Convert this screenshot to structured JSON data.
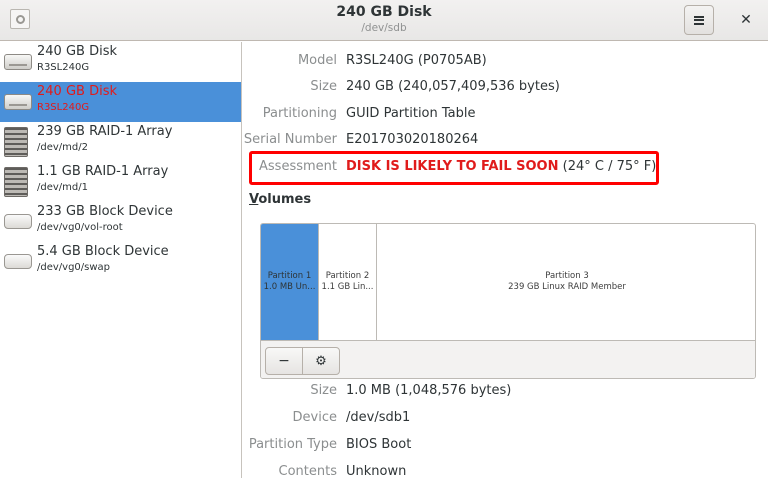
{
  "header": {
    "title": "240 GB Disk",
    "subtitle": "/dev/sdb",
    "menu_icon": "hamburger-menu-icon",
    "close_label": "✕"
  },
  "sidebar": {
    "items": [
      {
        "name": "240 GB Disk",
        "sub": "R3SL240G",
        "icon": "disk-icon",
        "selected": false
      },
      {
        "name": "240 GB Disk",
        "sub": "R3SL240G",
        "icon": "disk-icon",
        "selected": true
      },
      {
        "name": "239 GB RAID-1 Array",
        "sub": "/dev/md/2",
        "icon": "raid-icon",
        "selected": false
      },
      {
        "name": "1.1 GB RAID-1 Array",
        "sub": "/dev/md/1",
        "icon": "raid-icon",
        "selected": false
      },
      {
        "name": "233 GB Block Device",
        "sub": "/dev/vg0/vol-root",
        "icon": "block-icon",
        "selected": false
      },
      {
        "name": "5.4 GB Block Device",
        "sub": "/dev/vg0/swap",
        "icon": "block-icon",
        "selected": false
      }
    ]
  },
  "details": {
    "model": {
      "label": "Model",
      "value": "R3SL240G (P0705AB)"
    },
    "size": {
      "label": "Size",
      "value": "240 GB (240,057,409,536 bytes)"
    },
    "partitioning": {
      "label": "Partitioning",
      "value": "GUID Partition Table"
    },
    "serial": {
      "label": "Serial Number",
      "value": "E201703020180264"
    },
    "assessment": {
      "label": "Assessment",
      "warning": "DISK IS LIKELY TO FAIL SOON",
      "temp": "(24° C / 75° F)"
    }
  },
  "volumes": {
    "title_underlined": "V",
    "title_rest": "olumes",
    "partitions": [
      {
        "line1": "Partition 1",
        "line2": "1.0 MB Un...",
        "selected": true
      },
      {
        "line1": "Partition 2",
        "line2": "1.1 GB Lin...",
        "selected": false
      },
      {
        "line1": "Partition 3",
        "line2": "239 GB Linux RAID Member",
        "selected": false
      }
    ],
    "toolbar": {
      "minus_label": "−",
      "gear_label": "⚙"
    }
  },
  "partition_info": {
    "size": {
      "label": "Size",
      "value": "1.0 MB (1,048,576 bytes)"
    },
    "device": {
      "label": "Device",
      "value": "/dev/sdb1"
    },
    "type": {
      "label": "Partition Type",
      "value": "BIOS Boot"
    },
    "contents": {
      "label": "Contents",
      "value": "Unknown"
    }
  },
  "colors": {
    "accent": "#4a90d9",
    "warning": "#e01b1b",
    "highlight_box": "#ff0000"
  }
}
